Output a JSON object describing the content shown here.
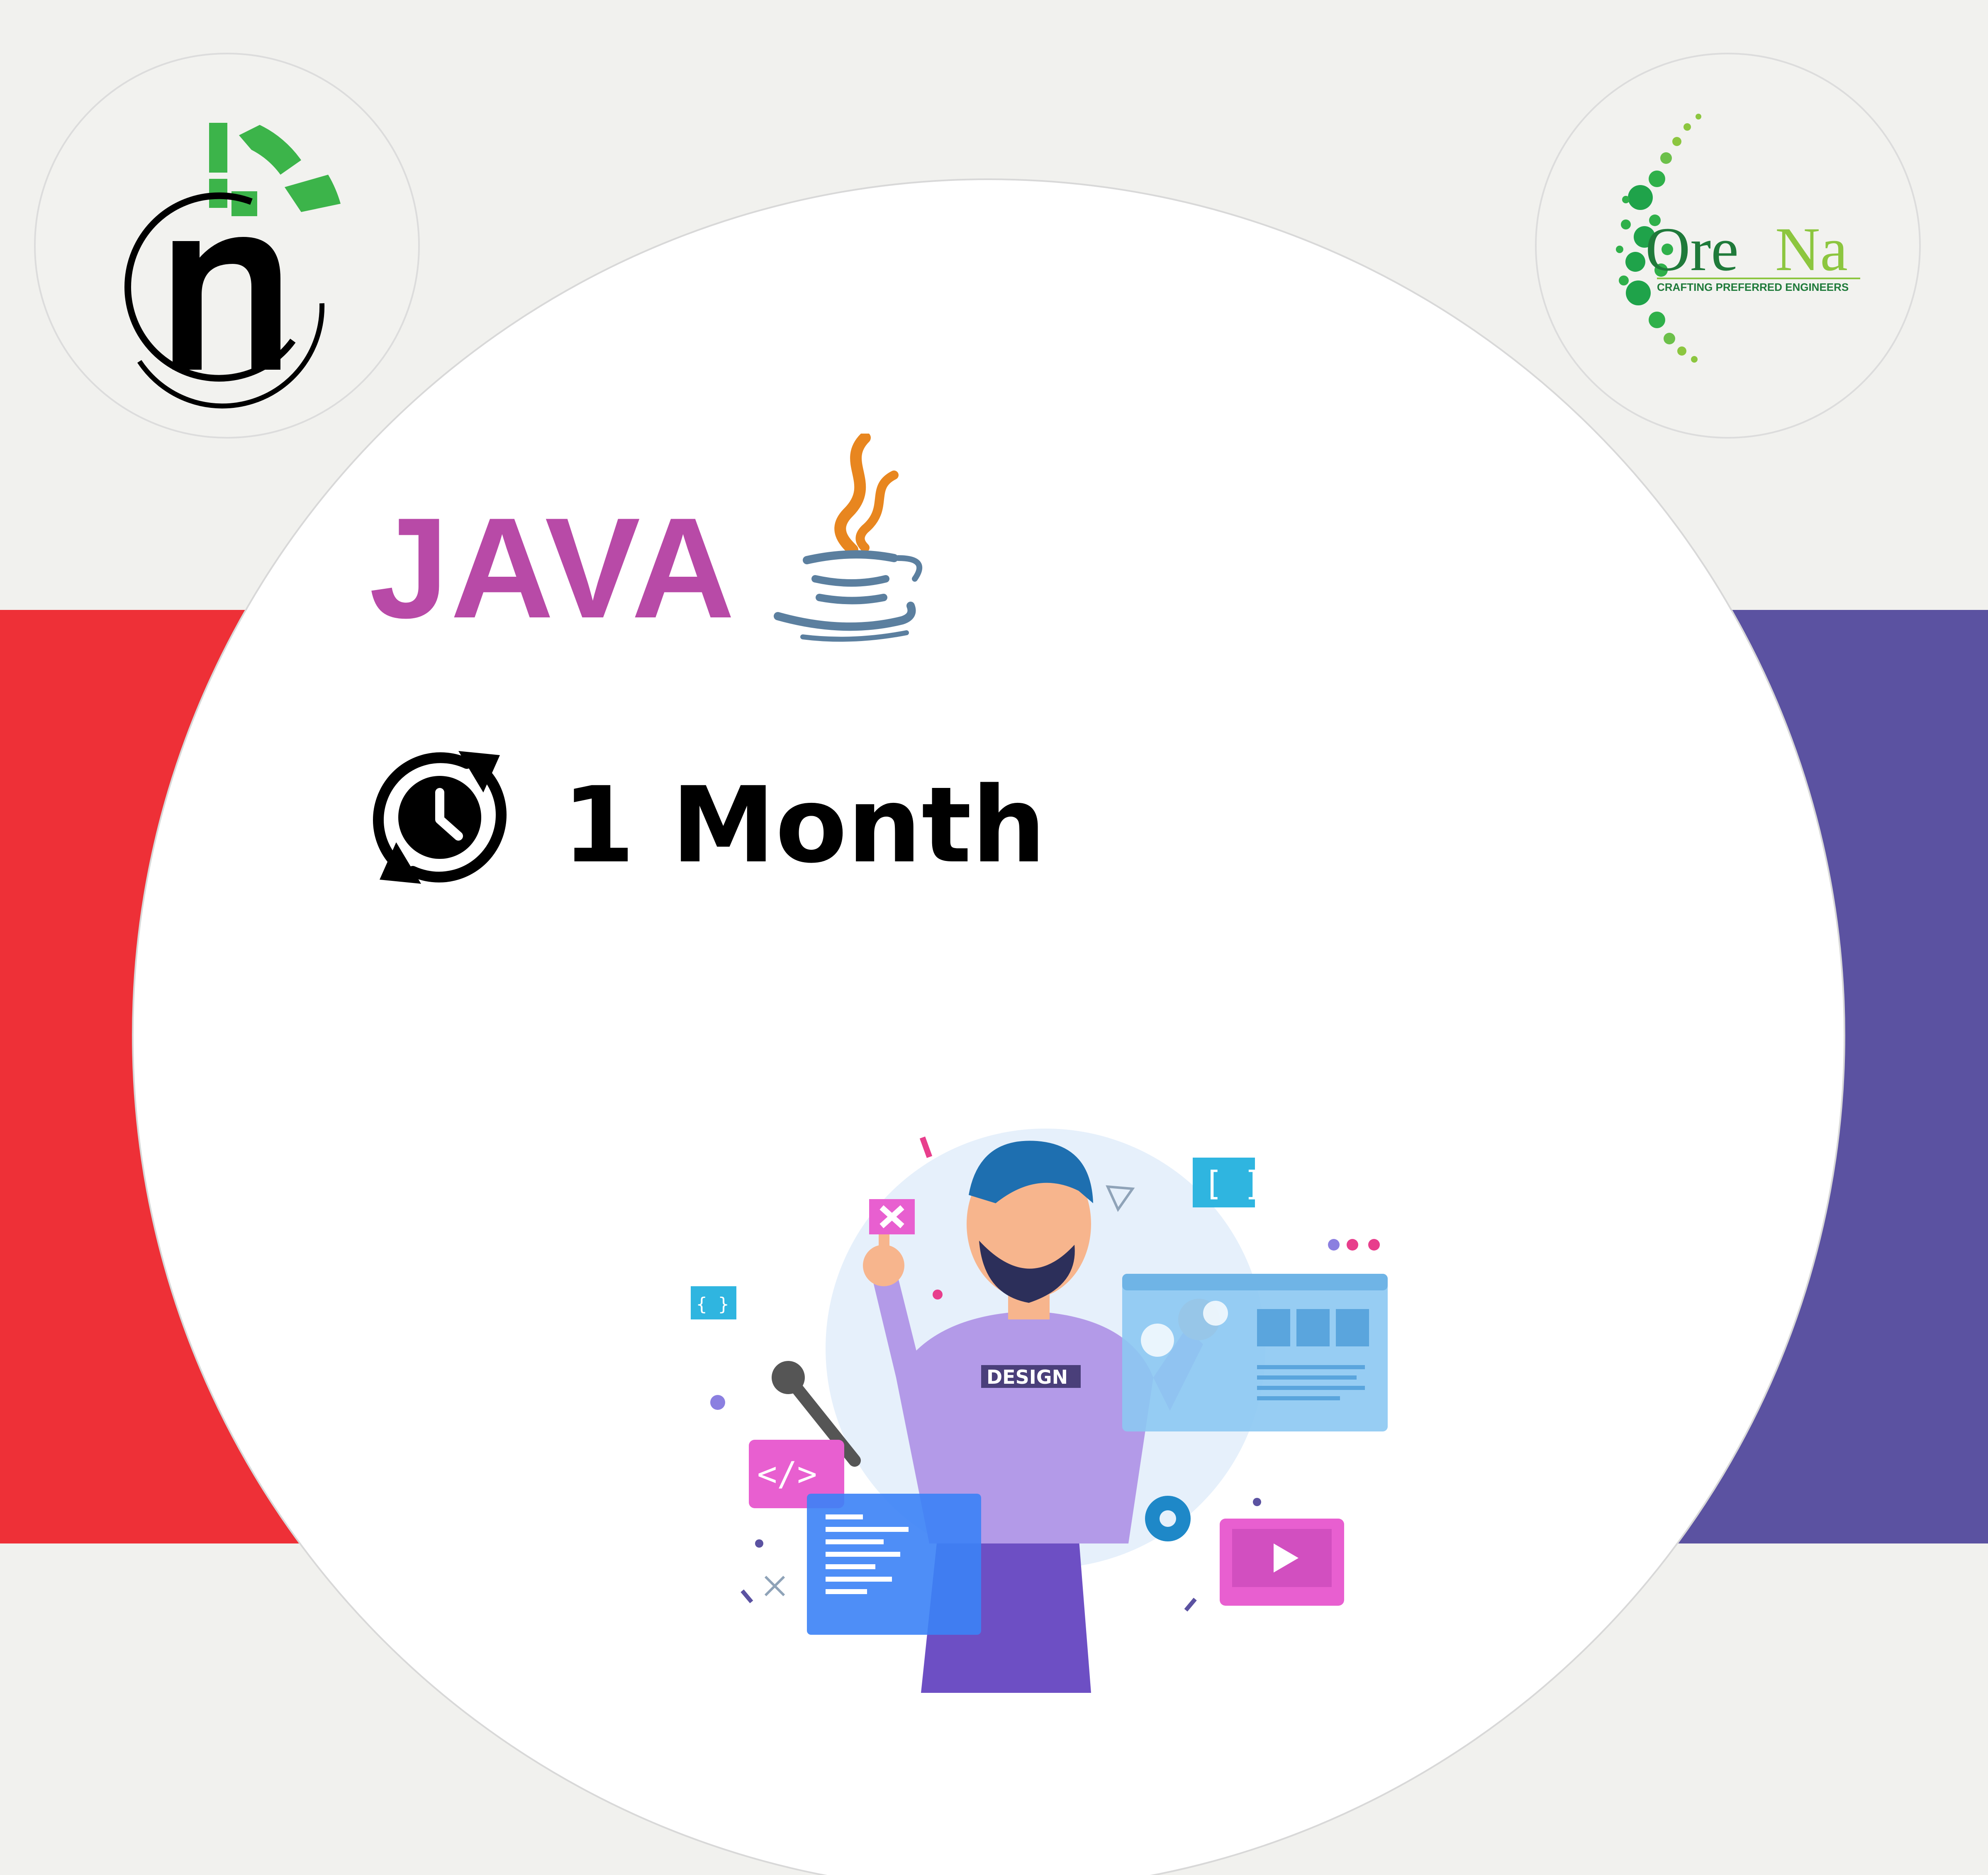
{
  "course": {
    "title": "JAVA",
    "duration": "1 Month"
  },
  "partners": {
    "right_logo": {
      "name_part1": "Ore",
      "name_part2": "Na",
      "tagline": "CRAFTING PREFERRED ENGINEERS"
    }
  },
  "illustration": {
    "shirt_label": "DESIGN"
  },
  "icons": {
    "left_logo": "n-logo-icon",
    "java": "java-coffee-cup-icon",
    "duration": "clock-refresh-icon"
  },
  "colors": {
    "background": "#f1f1ee",
    "band_left": "#ee3037",
    "band_right": "#5b52a1",
    "title": "#b84aa7",
    "logo_green": "#3cb44a",
    "orena_green": "#1f7a3a",
    "orena_lime": "#8cc63f",
    "java_orange": "#e8861f",
    "java_blue": "#5b7f9f"
  }
}
